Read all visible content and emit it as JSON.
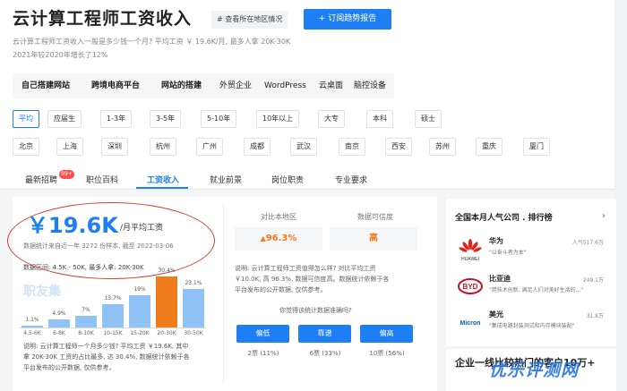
{
  "header": {
    "title": "云计算工程师工资收入",
    "area_chip": "# 查看所在地区情况",
    "subscribe": "+ 订阅趋势报告",
    "desc1": "云计算工程师工资收入一般是多少钱一个月? 平均工资 ￥ 19.6K/月, 最多人拿 20K-30K",
    "desc2": "2021年较2020年增长了12%"
  },
  "hot_links": [
    "自己搭建网站",
    "跨境电商平台",
    "网站的搭建",
    "外贸企业",
    "WordPress",
    "云桌面",
    "脑控设备"
  ],
  "filter_exp": [
    "平均",
    "应届生",
    "1-3年",
    "3-5年",
    "5-10年",
    "10年以上",
    "大专",
    "本科",
    "硕士"
  ],
  "filter_city": [
    "北京",
    "上海",
    "深圳",
    "杭州",
    "广州",
    "成都",
    "武汉",
    "南京",
    "西安",
    "苏州",
    "重庆",
    "厦门"
  ],
  "tabs": [
    "最新招聘",
    "职位百科",
    "工资收入",
    "就业前景",
    "岗位职责",
    "专业要求"
  ],
  "badge": "99+",
  "salary": {
    "value": "￥19.6K",
    "unit": "/月平均工资",
    "source": "数据统计来自近一年 3272 份样本, 截至 2022-03-06",
    "range": "数据区间: 4.5K - 50K, 最多人拿: 20K-30K",
    "watermark": "职友集",
    "foot1": "说明: 云计算工程师一个月多少钱? 平均工资 ￥19.6K, 其中",
    "foot2": "拿 20K-30K 工资的占比最多, 达 30.4%, 数据统计依赖于各",
    "foot3": "平台发布的公开数据, 仅供参考。"
  },
  "chart_data": {
    "type": "bar",
    "categories": [
      "4.5-6K",
      "6-8K",
      "8-10K",
      "10-15K",
      "15-20K",
      "20-30K",
      "30-50K"
    ],
    "values": [
      1.1,
      4.9,
      7,
      13.7,
      19,
      30.4,
      23.1
    ],
    "labels": [
      "1.1%",
      "4.9%",
      "7%",
      "13.7%",
      "19%",
      "30.4%",
      "23.1%"
    ],
    "highlight_index": 5,
    "highlight_color": "#f07b1b",
    "bar_color": "#8fc3f6"
  },
  "compare": {
    "h1": "对比本地区",
    "h2": "数据可信度",
    "v1": "96.3%",
    "v2": "高",
    "note1": "说明: 云计算工程师工资值得怎么样? 对比平均工资",
    "note2": "￥10.0K, 高 96.3%, 数据可信度高。数据统计依赖于各",
    "note3": "平台发布的公开数据, 仅供参考。",
    "question": "你觉得该统计数据准确吗?",
    "votes": [
      {
        "label": "偏低",
        "count": "2票 (11%)"
      },
      {
        "label": "靠谱",
        "count": "6票 (33%)"
      },
      {
        "label": "偏高",
        "count": "10票 (56%)"
      }
    ]
  },
  "ranking": {
    "title": "全国本月人气公司 . 排行榜",
    "companies": [
      {
        "name": "华为",
        "pop": "人气517.6万",
        "slogan": "\"以奋斗者为本\"",
        "logo": "HUAWEI"
      },
      {
        "name": "比亚迪",
        "pop": "249.1万",
        "slogan": "\"用技术创新, 满足人们对美好生活的...\"",
        "logo": "BYD"
      },
      {
        "name": "美光",
        "pop": "31.8万",
        "slogan": "\"集成电路封装测试和内存模块装配\"",
        "logo": "Micron"
      }
    ],
    "section2": "企业一线比较热门的客户10万+"
  },
  "watermark": "优乐评测网"
}
